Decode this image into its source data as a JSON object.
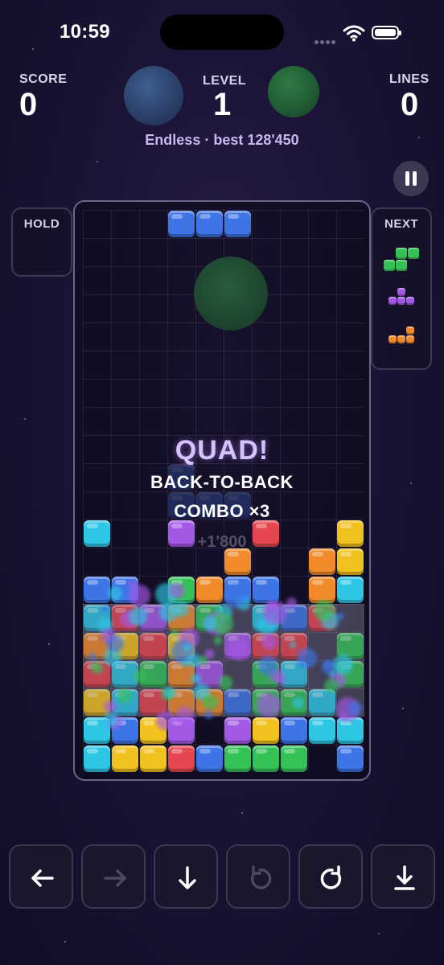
{
  "status_bar": {
    "time": "10:59"
  },
  "header": {
    "score_label": "SCORE",
    "score": "0",
    "level_label": "LEVEL",
    "level": "1",
    "lines_label": "LINES",
    "lines": "0",
    "mode_text": "Endless · best 128'450"
  },
  "panels": {
    "hold_label": "HOLD",
    "next_label": "NEXT"
  },
  "combo": {
    "title": "QUAD!",
    "subtitle": "BACK-TO-BACK",
    "multiplier": "COMBO ×3",
    "points": "+1'800"
  },
  "colors": {
    "cyan": "#2fc6e6",
    "blue": "#3d74e6",
    "purple": "#a458e6",
    "yellow": "#f1c21d",
    "orange": "#f08a2a",
    "green": "#34c257",
    "red": "#e64650",
    "background": "#1b1436"
  },
  "controls": [
    {
      "icon": "arrow-left-icon",
      "enabled": true
    },
    {
      "icon": "arrow-right-icon",
      "enabled": false
    },
    {
      "icon": "arrow-down-icon",
      "enabled": true
    },
    {
      "icon": "rotate-ccw-icon",
      "enabled": false
    },
    {
      "icon": "rotate-cw-icon",
      "enabled": true
    },
    {
      "icon": "hard-drop-icon",
      "enabled": true
    }
  ],
  "board": {
    "columns": 10,
    "rows": 20,
    "active_piece": {
      "color": "blue",
      "cells": [
        [
          3,
          0
        ],
        [
          4,
          0
        ],
        [
          5,
          0
        ]
      ]
    },
    "ghost_piece": {
      "color": "blue",
      "cells": [
        [
          3,
          9
        ],
        [
          3,
          10
        ],
        [
          4,
          10
        ],
        [
          5,
          10
        ]
      ]
    },
    "stack": [
      {
        "row": 11,
        "cells": [
          [
            "cyan",
            0
          ],
          [
            "purple",
            3
          ],
          [
            "red",
            6
          ],
          [
            "yellow",
            9
          ]
        ]
      },
      {
        "row": 12,
        "cells": [
          [
            "orange",
            5
          ],
          [
            "orange",
            8
          ],
          [
            "yellow",
            9
          ]
        ]
      },
      {
        "row": 13,
        "cells": [
          [
            "blue",
            0
          ],
          [
            "blue",
            1
          ],
          [
            "green",
            3
          ],
          [
            "orange",
            4
          ],
          [
            "blue",
            5
          ],
          [
            "blue",
            6
          ],
          [
            "orange",
            8
          ],
          [
            "cyan",
            9
          ]
        ]
      },
      {
        "row": 14,
        "cells": [
          [
            "cyan",
            0
          ],
          [
            "red",
            1
          ],
          [
            "purple",
            2
          ],
          [
            "orange",
            3
          ],
          [
            "green",
            4
          ],
          [
            "cyan",
            6
          ],
          [
            "blue",
            7
          ],
          [
            "red",
            8
          ]
        ]
      },
      {
        "row": 15,
        "cells": [
          [
            "orange",
            0
          ],
          [
            "yellow",
            1
          ],
          [
            "red",
            2
          ],
          [
            "yellow",
            3
          ],
          [
            "purple",
            5
          ],
          [
            "red",
            6
          ],
          [
            "red",
            7
          ],
          [
            "green",
            9
          ]
        ]
      },
      {
        "row": 16,
        "cells": [
          [
            "red",
            0
          ],
          [
            "cyan",
            1
          ],
          [
            "green",
            2
          ],
          [
            "orange",
            3
          ],
          [
            "purple",
            4
          ],
          [
            "green",
            6
          ],
          [
            "cyan",
            7
          ],
          [
            "green",
            9
          ]
        ]
      },
      {
        "row": 17,
        "cells": [
          [
            "yellow",
            0
          ],
          [
            "cyan",
            1
          ],
          [
            "red",
            2
          ],
          [
            "orange",
            3
          ],
          [
            "orange",
            4
          ],
          [
            "blue",
            5
          ],
          [
            "green",
            6
          ],
          [
            "green",
            7
          ],
          [
            "cyan",
            8
          ]
        ]
      },
      {
        "row": 18,
        "cells": [
          [
            "cyan",
            0
          ],
          [
            "blue",
            1
          ],
          [
            "yellow",
            2
          ],
          [
            "purple",
            3
          ],
          [
            "purple",
            5
          ],
          [
            "yellow",
            6
          ],
          [
            "blue",
            7
          ],
          [
            "cyan",
            8
          ],
          [
            "cyan",
            9
          ]
        ]
      },
      {
        "row": 19,
        "cells": [
          [
            "cyan",
            0
          ],
          [
            "yellow",
            1
          ],
          [
            "yellow",
            2
          ],
          [
            "red",
            3
          ],
          [
            "blue",
            4
          ],
          [
            "green",
            5
          ],
          [
            "green",
            6
          ],
          [
            "green",
            7
          ],
          [
            "blue",
            9
          ]
        ]
      }
    ],
    "clearing_rows": [
      14,
      15,
      16,
      17
    ]
  },
  "next_queue": [
    {
      "shape": "S",
      "color": "green"
    },
    {
      "shape": "T",
      "color": "purple"
    },
    {
      "shape": "L",
      "color": "orange"
    }
  ]
}
